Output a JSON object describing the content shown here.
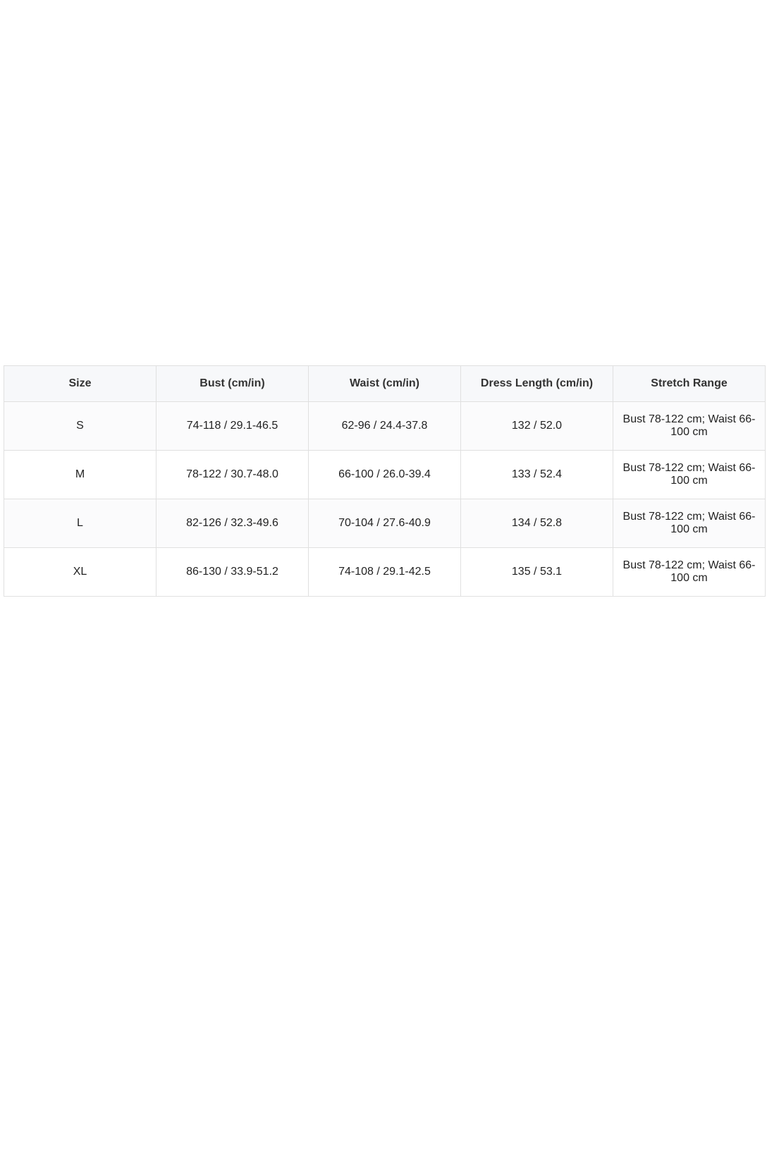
{
  "table": {
    "headers": [
      "Size",
      "Bust (cm/in)",
      "Waist (cm/in)",
      "Dress Length (cm/in)",
      "Stretch Range"
    ],
    "rows": [
      [
        "S",
        "74-118 / 29.1-46.5",
        "62-96 / 24.4-37.8",
        "132 / 52.0",
        "Bust 78-122 cm; Waist 66-100 cm"
      ],
      [
        "M",
        "78-122 / 30.7-48.0",
        "66-100 / 26.0-39.4",
        "133 / 52.4",
        "Bust 78-122 cm; Waist 66-100 cm"
      ],
      [
        "L",
        "82-126 / 32.3-49.6",
        "70-104 / 27.6-40.9",
        "134 / 52.8",
        "Bust 78-122 cm; Waist 66-100 cm"
      ],
      [
        "XL",
        "86-130 / 33.9-51.2",
        "74-108 / 29.1-42.5",
        "135 / 53.1",
        "Bust 78-122 cm; Waist 66-100 cm"
      ]
    ]
  }
}
